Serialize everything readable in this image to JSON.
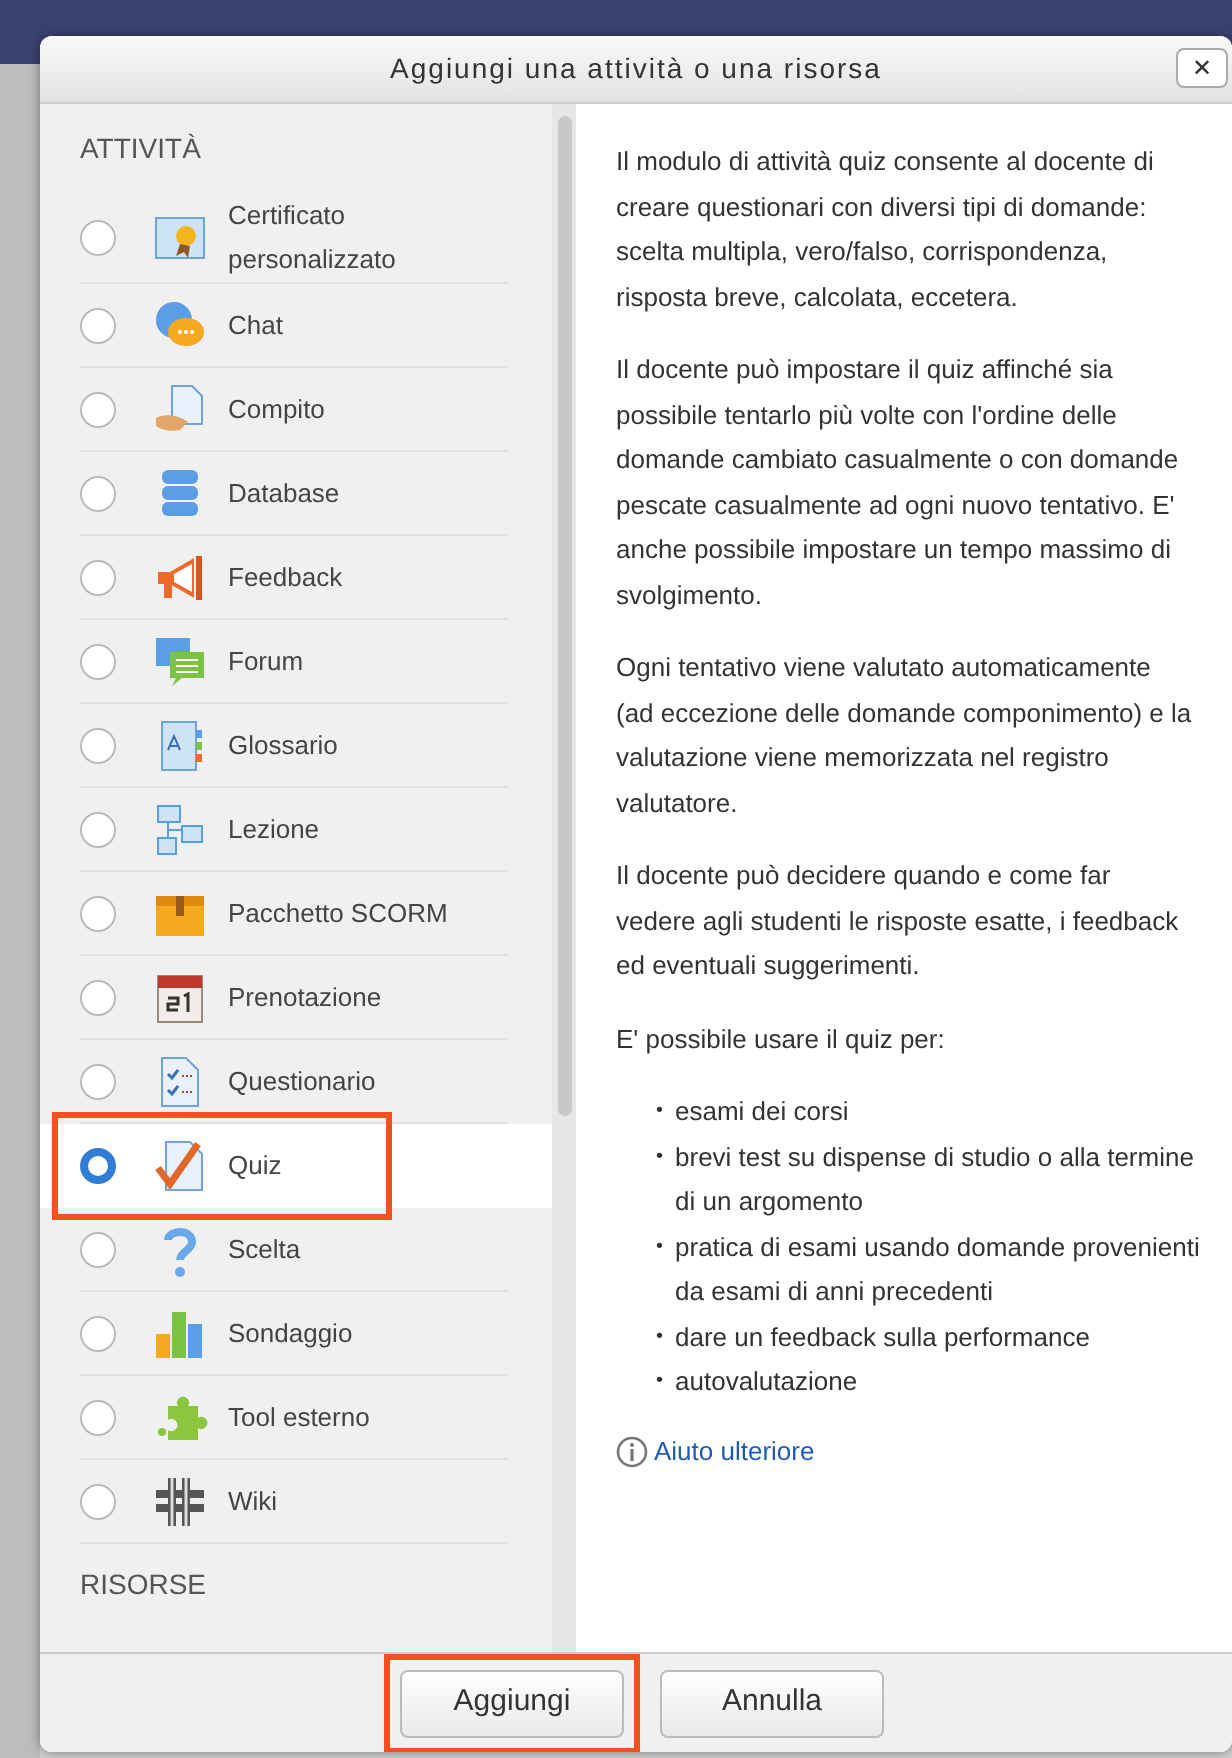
{
  "dialog": {
    "title": "Aggiungi una attività o una risorsa",
    "close": "✕"
  },
  "sections": [
    {
      "heading": "ATTIVITÀ",
      "items": [
        {
          "label": "Certificato personalizzato",
          "selected": false,
          "highlighted": false
        },
        {
          "label": "Chat",
          "selected": false,
          "highlighted": false
        },
        {
          "label": "Compito",
          "selected": false,
          "highlighted": false
        },
        {
          "label": "Database",
          "selected": false,
          "highlighted": false
        },
        {
          "label": "Feedback",
          "selected": false,
          "highlighted": false
        },
        {
          "label": "Forum",
          "selected": false,
          "highlighted": false
        },
        {
          "label": "Glossario",
          "selected": false,
          "highlighted": false
        },
        {
          "label": "Lezione",
          "selected": false,
          "highlighted": false
        },
        {
          "label": "Pacchetto SCORM",
          "selected": false,
          "highlighted": false
        },
        {
          "label": "Prenotazione",
          "selected": false,
          "highlighted": false
        },
        {
          "label": "Questionario",
          "selected": false,
          "highlighted": false
        },
        {
          "label": "Quiz",
          "selected": true,
          "highlighted": true
        },
        {
          "label": "Scelta",
          "selected": false,
          "highlighted": false
        },
        {
          "label": "Sondaggio",
          "selected": false,
          "highlighted": false
        },
        {
          "label": "Tool esterno",
          "selected": false,
          "highlighted": false
        },
        {
          "label": "Wiki",
          "selected": false,
          "highlighted": false
        }
      ]
    },
    {
      "heading": "RISORSE"
    }
  ],
  "description": {
    "paragraphs": [
      "Il modulo di attività quiz consente al docente di creare questionari con diversi tipi di domande: scelta multipla, vero/falso, corrispondenza, risposta breve, calcolata, eccetera.",
      "Il docente può impostare il quiz affinché sia possibile tentarlo più volte con l'ordine delle domande cambiato casualmente o con domande pescate casualmente ad ogni nuovo tentativo. E' anche possibile impostare un tempo massimo di svolgimento.",
      "Ogni tentativo viene valutato automaticamente (ad eccezione delle domande componimento) e la valutazione viene memorizzata nel registro valutatore.",
      "Il docente può decidere quando e come far vedere agli studenti le risposte esatte, i feedback ed eventuali suggerimenti.",
      "E' possibile usare il quiz per:"
    ],
    "bullets": [
      {
        "marker": "•",
        "text": "esami dei corsi"
      },
      {
        "marker": "•",
        "text": "brevi test su dispense di studio o alla termine di un argomento"
      },
      {
        "marker": "•",
        "text": "pratica di esami usando domande provenienti da esami di anni precedenti"
      },
      {
        "marker": "•",
        "text": "dare un feedback sulla performance"
      },
      {
        "marker": "•",
        "text": "autovalutazione"
      }
    ],
    "help_link": "Aiuto ulteriore"
  },
  "buttons": [
    {
      "label": "Aggiungi",
      "highlighted": true
    },
    {
      "label": "Annulla",
      "highlighted": false
    }
  ]
}
